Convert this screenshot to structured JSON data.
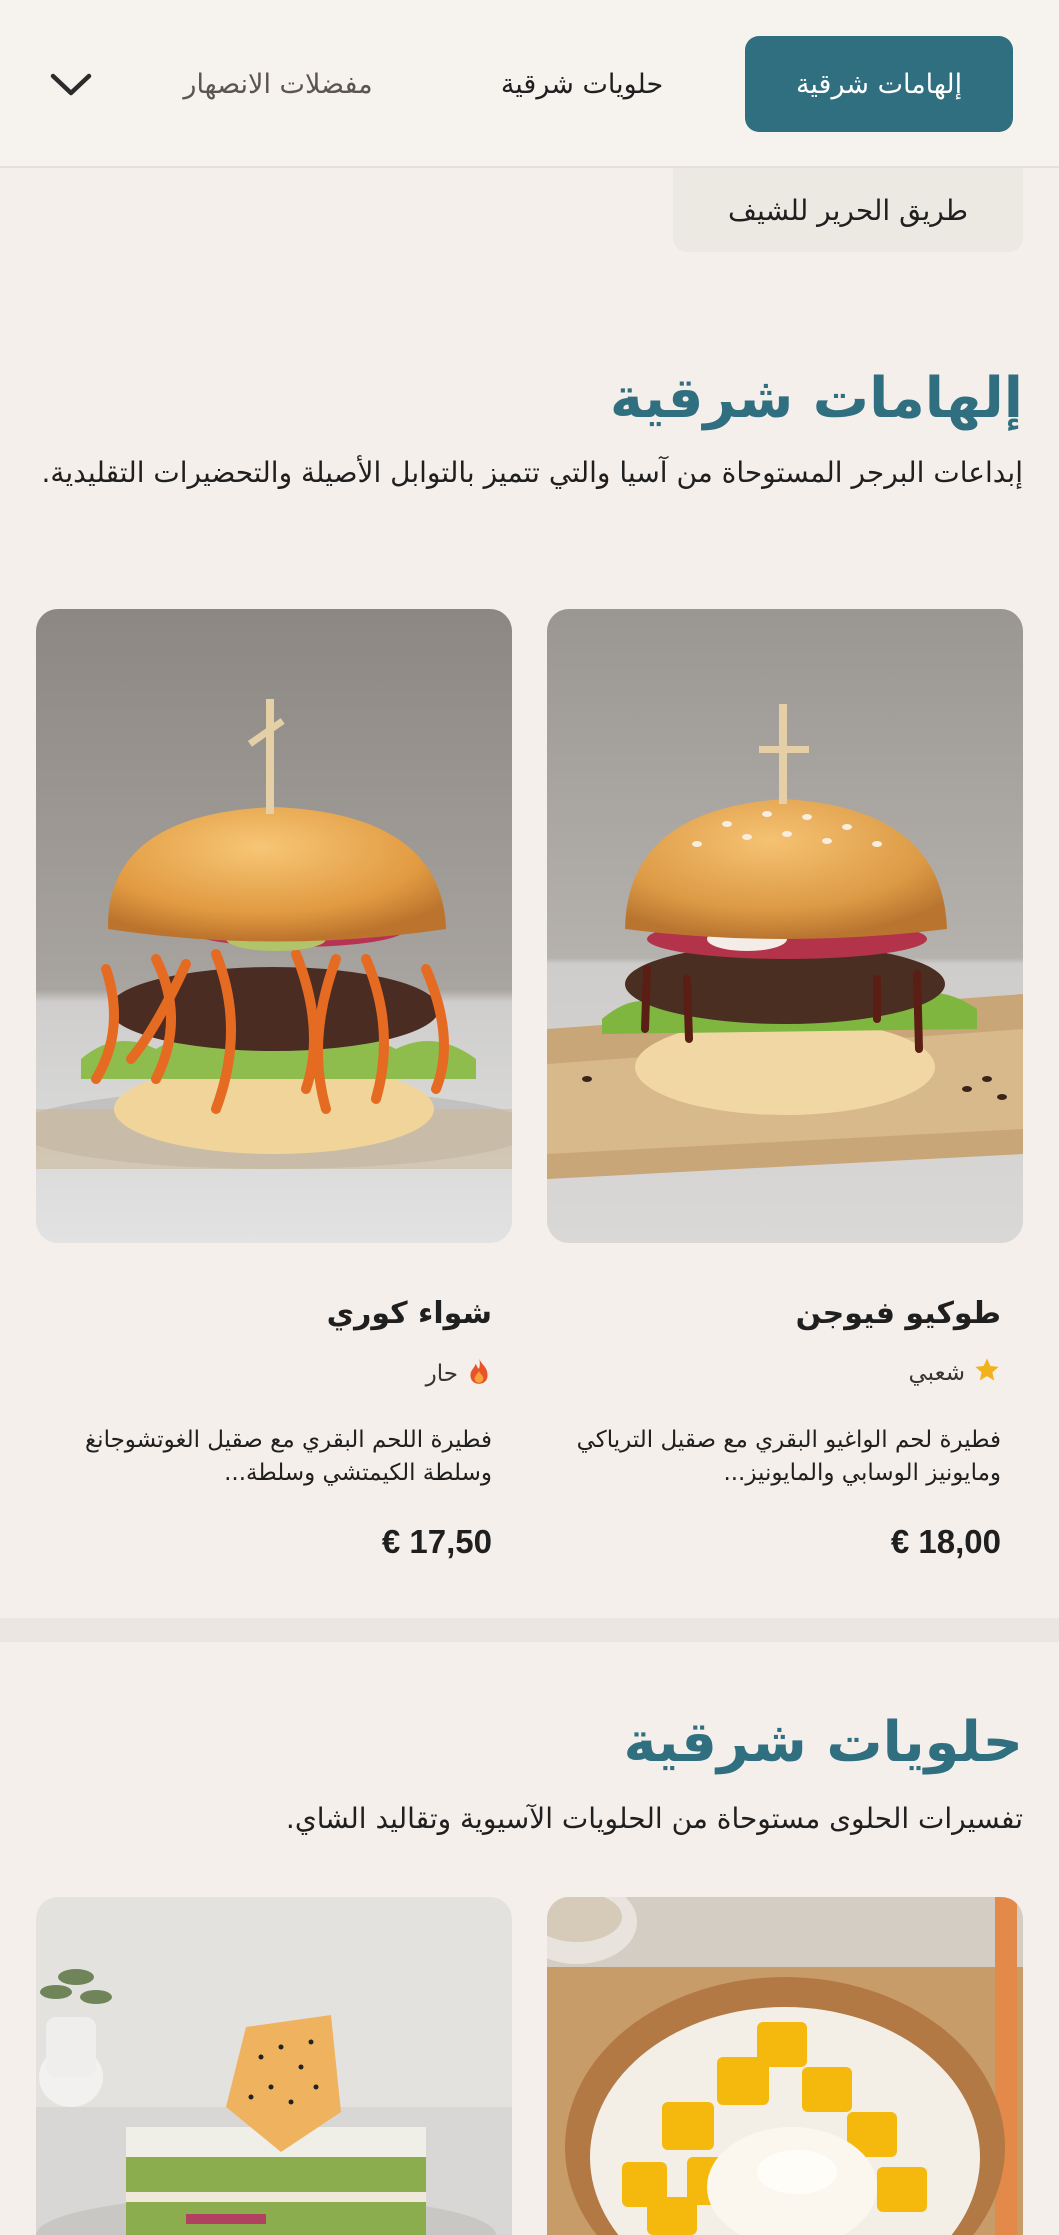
{
  "nav": {
    "tabs": [
      {
        "label": "إلهامات شرقية",
        "active": true
      },
      {
        "label": "حلويات شرقية",
        "active": false
      },
      {
        "label": "مفضلات الانصهار",
        "active": false
      }
    ],
    "overflow_icon": "chevron-down-icon",
    "chip_label": "طريق الحرير للشيف"
  },
  "sections": [
    {
      "title": "إلهامات شرقية",
      "description": "إبداعات البرجر المستوحاة من آسيا والتي تتميز بالتوابل الأصيلة والتحضيرات التقليدية.",
      "items": [
        {
          "name": "طوكيو فيوجن",
          "tag": "شعبي",
          "tag_icon": "star-icon",
          "description": "فطيرة لحم الواغيو البقري مع صقيل الترياكي ومايونيز الوسابي والمايونيز...",
          "price": "18,00 €"
        },
        {
          "name": "شواء كوري",
          "tag": "حار",
          "tag_icon": "fire-icon",
          "description": "فطيرة اللحم البقري مع صقيل الغوتشوجانغ وسلطة الكيمتشي وسلطة...",
          "price": "17,50 €"
        }
      ]
    },
    {
      "title": "حلويات شرقية",
      "description": "تفسيرات الحلوى مستوحاة من الحلويات الآسيوية وتقاليد الشاي.",
      "items": [
        {
          "name": "",
          "image": "mango-sticky-rice"
        },
        {
          "name": "",
          "image": "matcha-cake"
        }
      ]
    }
  ],
  "colors": {
    "accent": "#2f6f80",
    "background": "#f5efeb",
    "star": "#f2b21b",
    "fire": "#e8542a"
  }
}
